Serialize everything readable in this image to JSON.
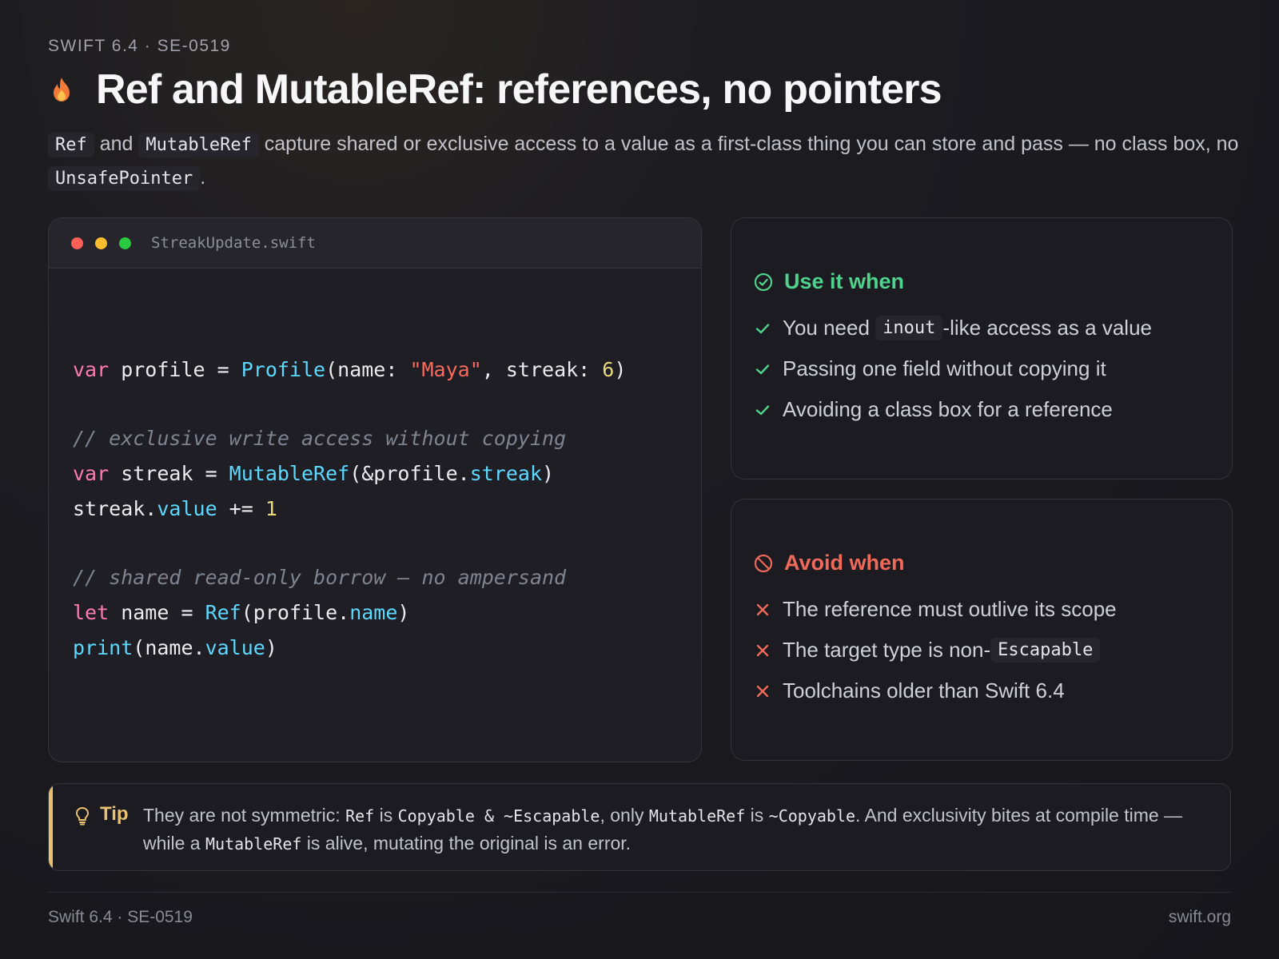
{
  "eyebrow": "SWIFT 6.4 · SE-0519",
  "title": "Ref and MutableRef: references, no pointers",
  "lede": {
    "code1": "Ref",
    "t1": " and ",
    "code2": "MutableRef",
    "t2": " capture shared or exclusive access to a value as a first-class thing you can store and pass — no class box, no ",
    "code3": "UnsafePointer",
    "t3": "."
  },
  "code_card": {
    "filename": "StreakUpdate.swift",
    "dot_colors": [
      "#ff5f57",
      "#febc2e",
      "#28c840"
    ],
    "lines": {
      "l1": {
        "kw": "var",
        "a": " profile = ",
        "ty": "Profile",
        "b": "(name: ",
        "str": "\"Maya\"",
        "c": ", streak: ",
        "num": "6",
        "d": ")"
      },
      "c1": "// exclusive write access without copying",
      "l2": {
        "kw": "var",
        "a": " streak = ",
        "ty": "MutableRef",
        "b": "(&profile.",
        "prop": "streak",
        "c": ")"
      },
      "l3": {
        "a": "streak.",
        "prop": "value",
        "b": " += ",
        "num": "1"
      },
      "c2": "// shared read-only borrow — no ampersand",
      "l4": {
        "kw": "let",
        "a": " name = ",
        "ty": "Ref",
        "b": "(profile.",
        "prop": "name",
        "c": ")"
      },
      "l5": {
        "fn": "print",
        "a": "(name.",
        "prop": "value",
        "b": ")"
      }
    }
  },
  "use_when": {
    "heading": "Use it when",
    "items": [
      {
        "pre": "You need ",
        "code": "inout",
        "post": "-like access as a value"
      },
      {
        "text": "Passing one field without copying it"
      },
      {
        "text": "Avoiding a class box for a reference"
      }
    ]
  },
  "avoid_when": {
    "heading": "Avoid when",
    "items": [
      {
        "text": "The reference must outlive its scope"
      },
      {
        "pre": "The target type is non-",
        "code": "Escapable"
      },
      {
        "text": "Toolchains older than Swift 6.4"
      }
    ]
  },
  "tip": {
    "label": "Tip",
    "t1": "They are not symmetric: ",
    "c1": "Ref",
    "t2": " is ",
    "c2": "Copyable & ~Escapable",
    "t3": ", only ",
    "c3": "MutableRef",
    "t4": " is ",
    "c4": "~Copyable",
    "t5": ". And exclusivity bites at compile time — while a ",
    "c5": "MutableRef",
    "t6": " is alive, mutating the original is an error."
  },
  "footer": {
    "left": "Swift 6.4 · SE-0519",
    "right": "swift.org"
  },
  "colors": {
    "accent_green": "#4fd38c",
    "accent_red": "#f06a5a",
    "tip_amber": "#e8c070",
    "flame": "#f47a3a"
  }
}
